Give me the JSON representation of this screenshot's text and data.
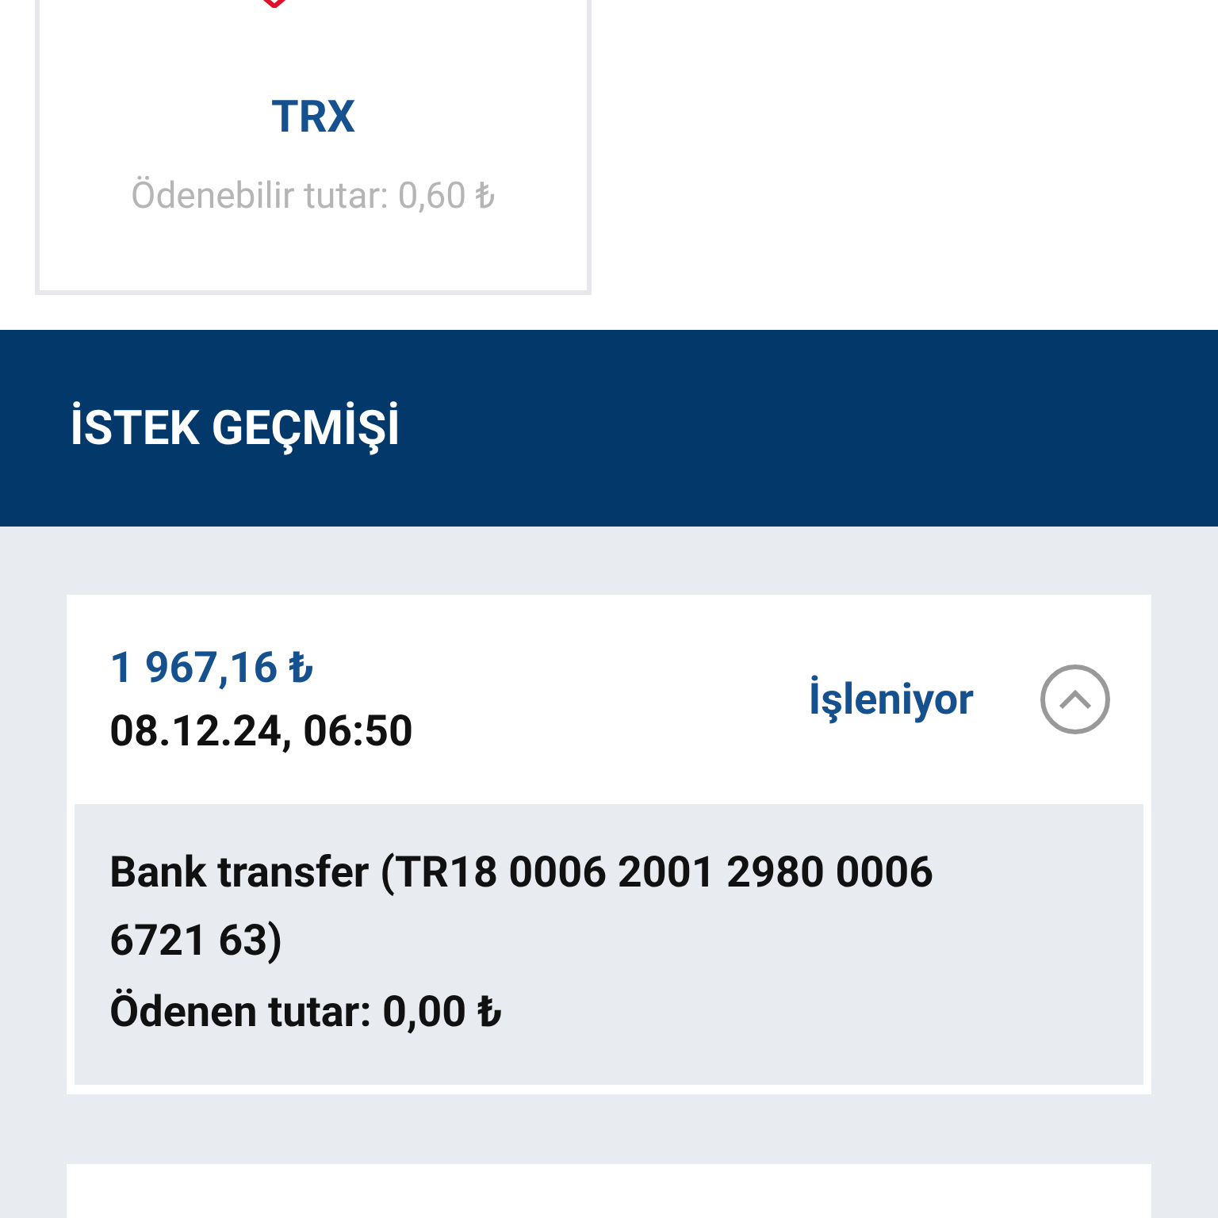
{
  "payment_method": {
    "name": "TRX",
    "payable": "Ödenebilir tutar: 0,60 ₺"
  },
  "history": {
    "title": "İSTEK GEÇMİŞİ",
    "requests": [
      {
        "amount": "1 967,16 ₺",
        "datetime": "08.12.24, 06:50",
        "status": "İşleniyor",
        "expanded": true,
        "method": "Bank transfer (TR18 0006 2001 2980 0006 6721 63)",
        "paid": "Ödenen tutar: 0,00 ₺"
      }
    ]
  }
}
